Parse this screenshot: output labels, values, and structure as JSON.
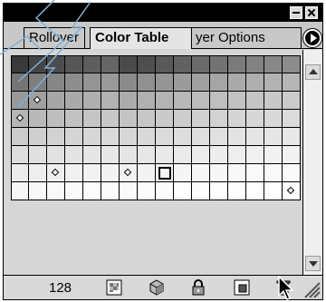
{
  "window": {
    "minimize_icon": "minimize-icon",
    "close_icon": "close-icon"
  },
  "tabs": [
    {
      "label": "Rollover",
      "active": false
    },
    {
      "label": "Color Table",
      "active": true
    },
    {
      "label": "yer Options",
      "active": false
    }
  ],
  "palette_menu_icon": "palette-menu-icon",
  "color_table": {
    "rows": [
      [
        "#3a3a3a",
        "#444444",
        "#4d4d4d",
        "#565656",
        "#5d5d5d",
        "#666666",
        "#4a4a4a",
        "#4f4f4f",
        "#595959",
        "#626262",
        "#6b6b6b",
        "#737373",
        "#7b7b7b",
        "#828282",
        "#888888",
        "#8c8c8c"
      ],
      [
        "#757575",
        "#7e7e7e",
        "#868686",
        "#8d8d8d",
        "#949494",
        "#9a9a9a",
        "#8a8a8a",
        "#909090",
        "#959595",
        "#9b9b9b",
        "#a0a0a0",
        "#a5a5a5",
        "#aaaaaa",
        "#afafaf",
        "#b3b3b3",
        "#b6b6b6"
      ],
      [
        "#999999",
        "#a0a0a0",
        "#a6a6a6",
        "#aaaaaa",
        "#afafaf",
        "#b3b3b3",
        "#acacac",
        "#b0b0b0",
        "#b4b4b4",
        "#b8b8b8",
        "#bcbcbc",
        "#bfbfbf",
        "#c2c2c2",
        "#c5c5c5",
        "#c8c8c8",
        "#cbcbcb"
      ],
      [
        "#b5b5b5",
        "#b9b9b9",
        "#bebebe",
        "#c1c1c1",
        "#c5c5c5",
        "#c8c8c8",
        "#c4c4c4",
        "#c7c7c7",
        "#cacaca",
        "#cdcdcd",
        "#d0d0d0",
        "#d2d2d2",
        "#d5d5d5",
        "#d7d7d7",
        "#d9d9d9",
        "#dbdbdb"
      ],
      [
        "#cccccc",
        "#cfcfcf",
        "#d2d2d2",
        "#d5d5d5",
        "#d7d7d7",
        "#dadada",
        "#d7d7d7",
        "#d9d9d9",
        "#dbdbdb",
        "#dddddd",
        "#dfdfdf",
        "#e1e1e1",
        "#e3e3e3",
        "#e5e5e5",
        "#e6e6e6",
        "#e8e8e8"
      ],
      [
        "#dddddd",
        "#e0e0e0",
        "#e2e2e2",
        "#e4e4e4",
        "#e6e6e6",
        "#e8e8e8",
        "#e5e5e5",
        "#e7e7e7",
        "#e9e9e9",
        "#eaeaea",
        "#ececec",
        "#ededed",
        "#eeeeee",
        "#f0f0f0",
        "#f1f1f1",
        "#f2f2f2"
      ],
      [
        "#ebebeb",
        "#eeeeee",
        "#efefef",
        "#f1f1f1",
        "#f2f2f2",
        "#f3f3f3",
        "#f2f2f2",
        "#f3f3f3",
        "#f4f4f4",
        "#f5f5f5",
        "#f6f6f6",
        "#f7f7f7",
        "#f8f8f8",
        "#f9f9f9",
        "#f9f9f9",
        "#fafafa"
      ],
      [
        "#f6f6f6",
        "#f8f8f8",
        "#f9f9f9",
        "#fafafa",
        "#fbfbfb",
        "#fcfcfc",
        "#fbfbfb",
        "#fcfcfc",
        "#fcfcfc",
        "#fdfdfd",
        "#fdfdfd",
        "#fefefe",
        "#fefefe",
        "#ffffff",
        "#ffffff",
        "#ffffff"
      ]
    ],
    "markers": [
      {
        "row": 2,
        "col": 1
      },
      {
        "row": 3,
        "col": 0
      },
      {
        "row": 6,
        "col": 2
      },
      {
        "row": 6,
        "col": 6
      },
      {
        "row": 7,
        "col": 15
      }
    ],
    "selected": {
      "row": 6,
      "col": 8
    }
  },
  "statusbar": {
    "color_count": "128",
    "icons": [
      "web-snap-icon",
      "shift-to-web-palette-icon",
      "lock-color-icon",
      "new-color-icon",
      "delete-color-icon"
    ]
  }
}
